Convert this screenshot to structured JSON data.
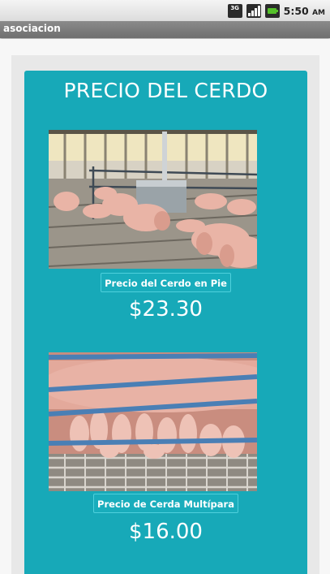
{
  "status_bar": {
    "network_label": "3G",
    "time": "5:50",
    "time_suffix": "AM"
  },
  "app": {
    "title": "asociacion"
  },
  "card": {
    "heading": "PRECIO DEL CERDO",
    "accent_color": "#17a9b8",
    "items": [
      {
        "label": "Precio del Cerdo en Pie",
        "price": "$23.30",
        "image": "pigs-pen-photo"
      },
      {
        "label": "Precio de Cerda Multípara",
        "price": "$16.00",
        "image": "sow-piglets-photo"
      }
    ]
  }
}
